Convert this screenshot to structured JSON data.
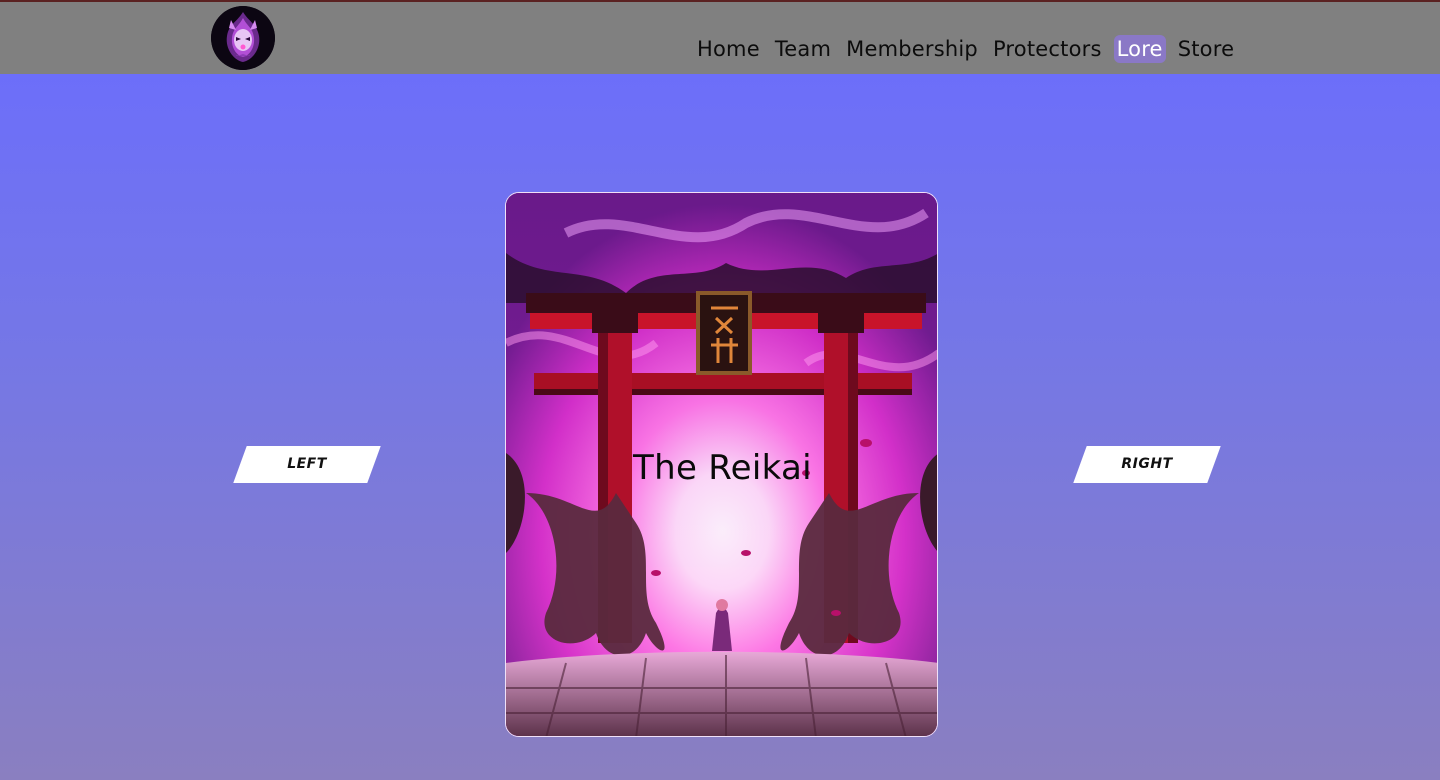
{
  "nav": {
    "items": [
      {
        "label": "Home",
        "active": false
      },
      {
        "label": "Team",
        "active": false
      },
      {
        "label": "Membership",
        "active": false
      },
      {
        "label": "Protectors",
        "active": false
      },
      {
        "label": "Lore",
        "active": true
      },
      {
        "label": "Store",
        "active": false
      }
    ]
  },
  "logo": {
    "icon": "flame-spirit-logo-icon"
  },
  "carousel": {
    "left_label": "LEFT",
    "right_label": "RIGHT",
    "card": {
      "title": "The Reikai",
      "image": "torii-gate-spirit-illustration"
    }
  },
  "colors": {
    "header_bg": "#808080",
    "page_gradient_top": "#6a6cff",
    "page_gradient_bottom": "#8a7fc0",
    "nav_active_bg": "#8a78c6",
    "nav_active_text": "#ffffff",
    "button_bg": "#ffffff"
  }
}
